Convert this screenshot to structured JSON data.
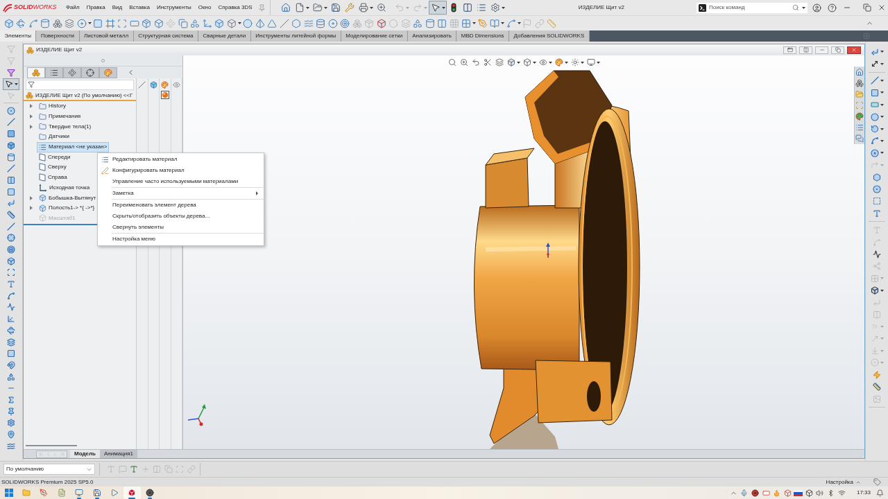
{
  "title_bar": {
    "logo_text": "**SOLID**WORKS",
    "menu": [
      "Файл",
      "Правка",
      "Вид",
      "Вставка",
      "Инструменты",
      "Окно",
      "Справка 3DS"
    ],
    "quick_access": [
      {
        "disabled": false,
        "selected": false
      },
      {
        "disabled": false,
        "selected": false
      },
      {
        "disabled": false,
        "selected": false
      },
      {
        "disabled": false,
        "selected": false
      },
      {
        "disabled": false,
        "selected": false
      },
      {
        "disabled": false,
        "selected": false
      },
      {
        "disabled": false,
        "selected": false
      },
      {
        "disabled": true,
        "selected": false
      },
      {
        "disabled": true,
        "selected": false
      },
      {
        "disabled": false,
        "selected": true
      },
      {
        "disabled": false,
        "selected": false
      },
      {
        "disabled": false,
        "selected": false
      },
      {
        "disabled": false,
        "selected": false
      },
      {
        "disabled": false,
        "selected": false
      }
    ],
    "document_title": "ИЗДЕЛИЕ Щит v2",
    "search": {
      "placeholder": "Поиск команд"
    }
  },
  "command_toolbar": {
    "buttons": [
      {
        "disabled": false
      },
      {
        "disabled": false
      },
      {
        "disabled": false
      },
      {
        "disabled": false
      },
      {
        "disabled": false
      },
      {
        "disabled": false
      },
      {
        "disabled": false
      },
      {
        "disabled": false
      },
      {
        "disabled": false
      },
      {
        "disabled": false
      },
      {
        "disabled": false
      },
      {
        "disabled": false
      },
      {
        "disabled": false
      },
      {
        "disabled": true
      },
      {
        "disabled": false
      },
      {
        "disabled": false
      },
      {
        "disabled": false
      },
      {
        "disabled": false
      },
      {
        "disabled": false
      },
      {
        "disabled": false
      },
      {
        "disabled": false
      },
      {
        "disabled": false
      },
      {
        "disabled": false
      },
      {
        "disabled": false
      },
      {
        "disabled": false
      },
      {
        "disabled": false
      },
      {
        "disabled": false
      },
      {
        "disabled": false
      },
      {
        "disabled": true
      },
      {
        "disabled": true
      },
      {
        "disabled": false
      },
      {
        "disabled": true
      },
      {
        "disabled": true
      },
      {
        "disabled": false
      },
      {
        "disabled": false
      },
      {
        "disabled": false
      },
      {
        "disabled": true
      },
      {
        "disabled": false
      },
      {
        "disabled": false
      },
      {
        "disabled": false
      },
      {
        "disabled": false
      },
      {
        "disabled": true
      },
      {
        "disabled": true
      },
      {
        "disabled": false
      }
    ]
  },
  "command_tabs": [
    {
      "label": "Элементы",
      "selected": true
    },
    {
      "label": "Поверхности",
      "selected": false
    },
    {
      "label": "Листовой металл",
      "selected": false
    },
    {
      "label": "Структурная система",
      "selected": false
    },
    {
      "label": "Сварные детали",
      "selected": false
    },
    {
      "label": "Инструменты литейной формы",
      "selected": false
    },
    {
      "label": "Моделирование сетки",
      "selected": false
    },
    {
      "label": "Анализировать",
      "selected": false
    },
    {
      "label": "MBD Dimensions",
      "selected": false
    },
    {
      "label": "Добавления SOLIDWORKS",
      "selected": false
    }
  ],
  "left_toolbar": {
    "buttons": [
      {
        "disabled": true,
        "selected": false
      },
      {
        "disabled": true,
        "selected": false
      },
      {
        "disabled": false,
        "selected": false
      },
      {
        "disabled": false,
        "selected": true
      },
      {
        "disabled": true,
        "selected": false
      },
      {
        "disabled": false,
        "selected": false
      },
      {
        "disabled": false,
        "selected": false
      },
      {
        "disabled": false,
        "selected": false
      },
      {
        "disabled": false,
        "selected": false
      },
      {
        "disabled": false,
        "selected": false
      },
      {
        "disabled": false,
        "selected": false
      },
      {
        "disabled": false,
        "selected": false
      },
      {
        "disabled": false,
        "selected": false
      },
      {
        "disabled": false,
        "selected": false
      },
      {
        "disabled": false,
        "selected": false
      },
      {
        "disabled": false,
        "selected": false
      },
      {
        "disabled": false,
        "selected": false
      },
      {
        "disabled": false,
        "selected": false
      },
      {
        "disabled": false,
        "selected": false
      },
      {
        "disabled": false,
        "selected": false
      },
      {
        "disabled": false,
        "selected": false
      },
      {
        "disabled": false,
        "selected": false
      },
      {
        "disabled": false,
        "selected": false
      },
      {
        "disabled": false,
        "selected": false
      },
      {
        "disabled": false,
        "selected": false
      },
      {
        "disabled": false,
        "selected": false
      },
      {
        "disabled": false,
        "selected": false
      },
      {
        "disabled": false,
        "selected": false
      },
      {
        "disabled": false,
        "selected": false
      },
      {
        "disabled": false,
        "selected": false
      },
      {
        "disabled": false,
        "selected": false
      },
      {
        "disabled": false,
        "selected": false
      },
      {
        "disabled": false,
        "selected": false
      },
      {
        "disabled": false,
        "selected": false
      },
      {
        "disabled": false,
        "selected": false
      }
    ]
  },
  "document_window": {
    "title": "ИЗДЕЛИЕ Щит v2"
  },
  "feature_manager": {
    "tabs": [
      {
        "selected": true
      },
      {
        "selected": false
      },
      {
        "selected": false
      },
      {
        "selected": false
      },
      {
        "selected": false
      }
    ],
    "root": "ИЗДЕЛИЕ Щит v2 (По умолчанию) <<Г",
    "items": [
      {
        "label": "History",
        "kind": "folder",
        "expandable": true,
        "selected": false,
        "disabled": false
      },
      {
        "label": "Примечания",
        "kind": "folder",
        "expandable": true,
        "selected": false,
        "disabled": false
      },
      {
        "label": "Твердые тела(1)",
        "kind": "folder",
        "expandable": true,
        "selected": false,
        "disabled": false
      },
      {
        "label": "Датчики",
        "kind": "folder",
        "expandable": false,
        "selected": false,
        "disabled": false
      },
      {
        "label": "Материал <не указан>",
        "kind": "material",
        "expandable": false,
        "selected": true,
        "disabled": false
      },
      {
        "label": "Спереди",
        "kind": "plane",
        "expandable": false,
        "selected": false,
        "disabled": false
      },
      {
        "label": "Сверху",
        "kind": "plane",
        "expandable": false,
        "selected": false,
        "disabled": false
      },
      {
        "label": "Справа",
        "kind": "plane",
        "expandable": false,
        "selected": false,
        "disabled": false
      },
      {
        "label": "Исходная точка",
        "kind": "origin",
        "expandable": false,
        "selected": false,
        "disabled": false
      },
      {
        "label": "Бобышка-Вытянут",
        "kind": "feature",
        "expandable": true,
        "selected": false,
        "disabled": false
      },
      {
        "label": "Полость1-> *{ ->*}",
        "kind": "feature",
        "expandable": true,
        "selected": false,
        "disabled": false
      },
      {
        "label": "Масштаб1",
        "kind": "feature",
        "expandable": false,
        "selected": false,
        "disabled": true
      }
    ]
  },
  "context_menu": {
    "groups": [
      [
        {
          "label": "Редактировать материал",
          "kind": "command"
        },
        {
          "label": "Конфигурировать материал",
          "kind": "command"
        },
        {
          "label": "Управление часто используемыми материалами",
          "kind": "command"
        }
      ],
      [
        {
          "label": "Заметка",
          "kind": "submenu"
        }
      ],
      [
        {
          "label": "Переименовать элемент дерева",
          "kind": "command"
        },
        {
          "label": "Скрыть/отобразить объекты дерева...",
          "kind": "command"
        },
        {
          "label": "Свернуть элементы",
          "kind": "command"
        }
      ],
      [
        {
          "label": "Настройка меню",
          "kind": "command"
        }
      ]
    ]
  },
  "right_toolbar": {
    "buttons": [
      {
        "disabled": false
      },
      {
        "disabled": false
      },
      {
        "disabled": false
      },
      {
        "disabled": false
      },
      {
        "disabled": false
      },
      {
        "disabled": false
      },
      {
        "disabled": false
      },
      {
        "disabled": false
      },
      {
        "disabled": false
      },
      {
        "disabled": true
      },
      {
        "disabled": false
      },
      {
        "disabled": false
      },
      {
        "disabled": false
      },
      {
        "disabled": false
      },
      {
        "disabled": true
      },
      {
        "disabled": true
      },
      {
        "disabled": false
      },
      {
        "disabled": true
      },
      {
        "disabled": true
      },
      {
        "disabled": false
      },
      {
        "disabled": true
      },
      {
        "disabled": true
      },
      {
        "disabled": true
      },
      {
        "disabled": true
      },
      {
        "disabled": true
      },
      {
        "disabled": true
      },
      {
        "disabled": false
      },
      {
        "disabled": false
      },
      {
        "disabled": true
      }
    ]
  },
  "bottom_tabs": {
    "nav": [
      {
        "disabled": true
      },
      {
        "disabled": true
      },
      {
        "disabled": true
      },
      {
        "disabled": true
      }
    ],
    "tabs": [
      {
        "label": "Модель",
        "selected": true
      },
      {
        "label": "Анимация1",
        "selected": false
      }
    ]
  },
  "configuration": {
    "value": "По умолчанию"
  },
  "format_toolbar": {
    "buttons": [
      {
        "disabled": true
      },
      {
        "disabled": true
      },
      {
        "disabled": false
      },
      {
        "disabled": true
      },
      {
        "disabled": true
      },
      {
        "disabled": true
      },
      {
        "disabled": true
      },
      {
        "disabled": true
      }
    ]
  },
  "status_bar": {
    "product": "SOLIDWORKS Premium 2025 SP5.0",
    "customize": "Настройка"
  },
  "taskbar": {
    "apps": [
      {
        "running": false,
        "selected": false
      },
      {
        "running": false,
        "selected": false
      },
      {
        "running": false,
        "selected": false
      },
      {
        "running": false,
        "selected": false
      },
      {
        "running": true,
        "selected": false
      },
      {
        "running": true,
        "selected": false
      },
      {
        "running": false,
        "selected": false
      },
      {
        "running": true,
        "selected": true
      },
      {
        "running": true,
        "selected": false
      }
    ],
    "time": "17:33"
  }
}
